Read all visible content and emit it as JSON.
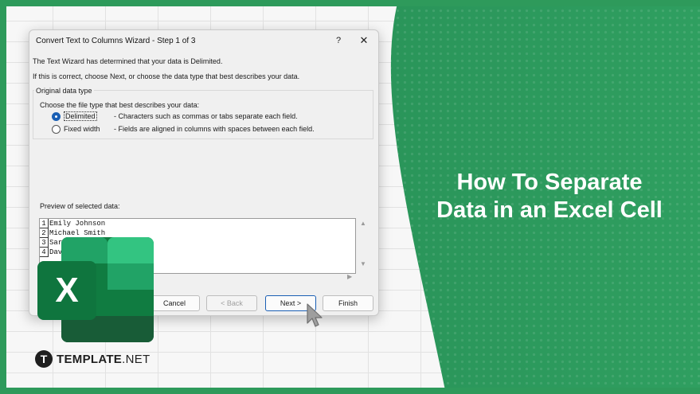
{
  "dialog": {
    "title": "Convert Text to Columns Wizard - Step 1 of 3",
    "help": "?",
    "close": "✕",
    "line1": "The Text Wizard has determined that your data is Delimited.",
    "line2": "If this is correct, choose Next, or choose the data type that best describes your data.",
    "group_label": "Original data type",
    "choose_label": "Choose the file type that best describes your data:",
    "options": [
      {
        "label": "Delimited",
        "description": "- Characters such as commas or tabs separate each field.",
        "checked": true
      },
      {
        "label": "Fixed width",
        "description": "- Fields are aligned in columns with spaces between each field.",
        "checked": false
      }
    ],
    "preview_label": "Preview of selected data:",
    "preview_rows": [
      {
        "num": "1",
        "text": "Emily Johnson"
      },
      {
        "num": "2",
        "text": "Michael Smith"
      },
      {
        "num": "3",
        "text": "Sarah"
      },
      {
        "num": "4",
        "text": "David"
      }
    ],
    "buttons": {
      "cancel": "Cancel",
      "back": "< Back",
      "next": "Next >",
      "finish": "Finish"
    }
  },
  "headline": {
    "line1": "How To Separate",
    "line2": "Data in an Excel Cell"
  },
  "logo": {
    "letter": "X"
  },
  "brand": {
    "mark": "T",
    "name_bold": "TEMPLATE",
    "name_light": ".NET"
  },
  "colors": {
    "brand_green": "#2e9a5b",
    "panel_green": "#2f9b5f",
    "excel_dark": "#185c37",
    "excel_mid": "#21a366",
    "excel_light": "#33c481",
    "excel_main": "#107c41",
    "primary_blue": "#1a5fb4"
  }
}
